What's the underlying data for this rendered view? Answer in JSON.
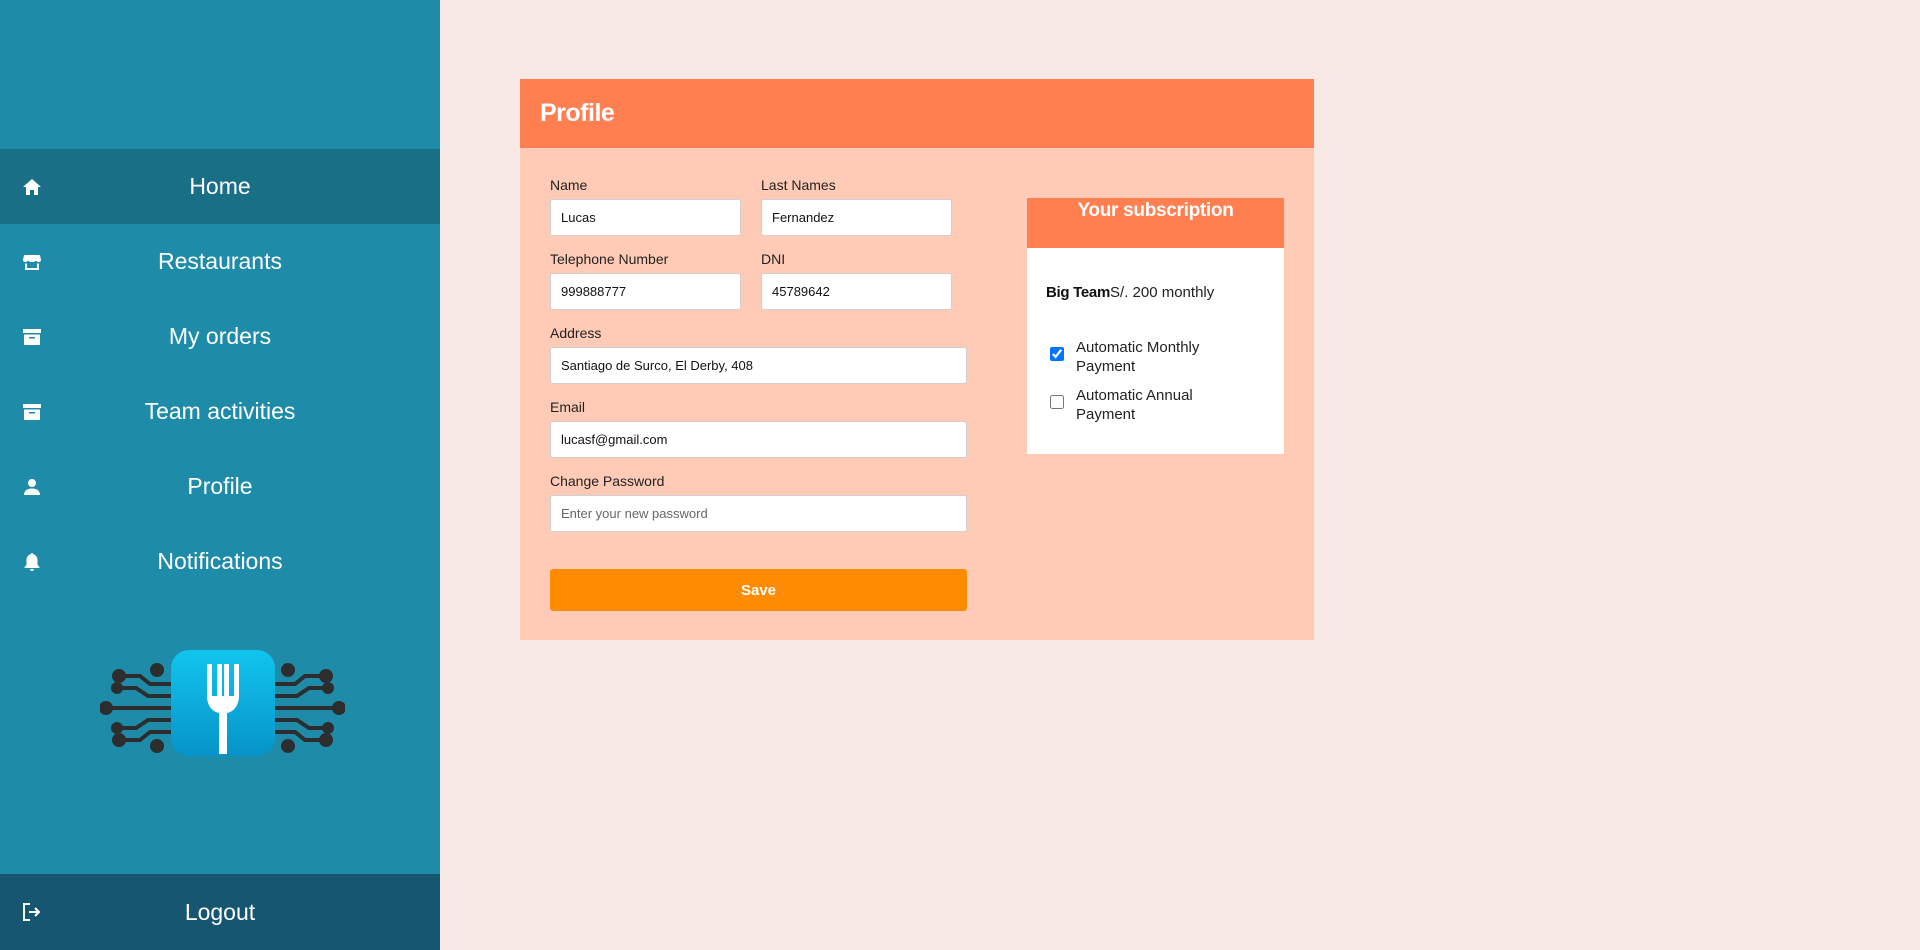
{
  "sidebar": {
    "items": [
      {
        "label": "Home",
        "icon": "home-icon",
        "active": true
      },
      {
        "label": "Restaurants",
        "icon": "store-icon"
      },
      {
        "label": "My orders",
        "icon": "archive-icon"
      },
      {
        "label": "Team activities",
        "icon": "archive-icon"
      },
      {
        "label": "Profile",
        "icon": "person-icon"
      },
      {
        "label": "Notifications",
        "icon": "bell-icon"
      }
    ],
    "logout_label": "Logout",
    "logout_icon": "logout-icon",
    "logo_icon": "fork-circuit-logo"
  },
  "profile": {
    "title": "Profile",
    "fields": {
      "name": {
        "label": "Name",
        "value": "Lucas"
      },
      "last_names": {
        "label": "Last Names",
        "value": "Fernandez"
      },
      "telephone": {
        "label": "Telephone Number",
        "value": "999888777"
      },
      "dni": {
        "label": "DNI",
        "value": "45789642"
      },
      "address": {
        "label": "Address",
        "value": "Santiago de Surco, El Derby, 408"
      },
      "email": {
        "label": "Email",
        "value": "lucasf@gmail.com"
      },
      "password": {
        "label": "Change Password",
        "placeholder": "Enter your new password"
      }
    },
    "save_label": "Save"
  },
  "subscription": {
    "title": "Your subscription",
    "plan_name": "Big Team",
    "plan_price": "S/. 200 monthly",
    "options": [
      {
        "label": "Automatic Monthly Payment",
        "checked": true
      },
      {
        "label": "Automatic Annual Payment",
        "checked": false
      }
    ]
  },
  "colors": {
    "sidebar": "#1e8ba8",
    "sidebar_active": "#186f86",
    "logout_bg": "#175670",
    "page_bg": "#f9e9e6",
    "card_bg": "#ffcbb7",
    "header": "#ff7f50",
    "save_button": "#ff8c00"
  }
}
